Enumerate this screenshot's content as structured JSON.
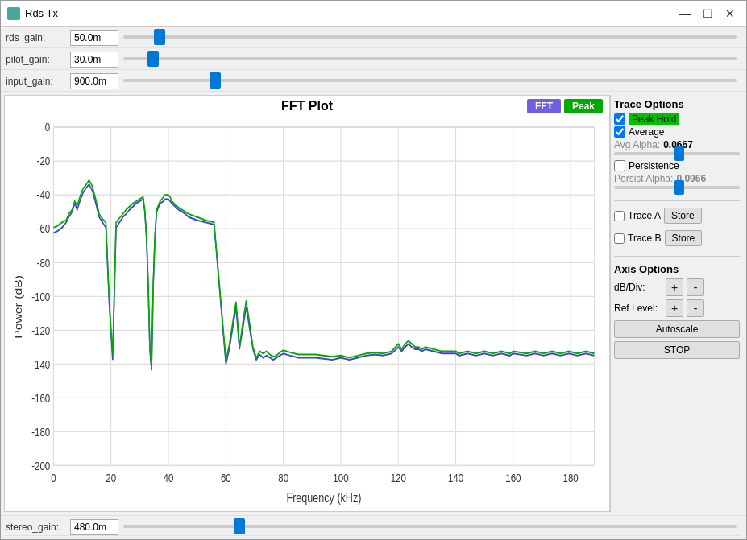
{
  "window": {
    "title": "Rds Tx",
    "icon": "rds-icon"
  },
  "sliders": [
    {
      "id": "rds_gain",
      "label": "rds_gain:",
      "value": "50.0m",
      "thumb_pct": 5
    },
    {
      "id": "pilot_gain",
      "label": "pilot_gain:",
      "value": "30.0m",
      "thumb_pct": 4
    },
    {
      "id": "input_gain",
      "label": "input_gain:",
      "value": "900.0m",
      "thumb_pct": 14
    }
  ],
  "plot": {
    "title": "FFT Plot",
    "btn_fft": "FFT",
    "btn_peak": "Peak",
    "x_label": "Frequency (kHz)",
    "y_label": "Power (dB)",
    "x_ticks": [
      "0",
      "20",
      "40",
      "60",
      "80",
      "100",
      "120",
      "140",
      "160",
      "180"
    ],
    "y_ticks": [
      "0",
      "-20",
      "-40",
      "-60",
      "-80",
      "-100",
      "-120",
      "-140",
      "-160",
      "-180",
      "-200"
    ]
  },
  "trace_options": {
    "title": "Trace Options",
    "peak_hold_label": "Peak Hold",
    "peak_hold_checked": true,
    "average_label": "Average",
    "average_checked": true,
    "avg_alpha_label": "Avg Alpha:",
    "avg_alpha_value": "0.0667",
    "avg_slider_pct": 50,
    "persistence_label": "Persistence",
    "persistence_checked": false,
    "persist_alpha_label": "Persist Alpha:",
    "persist_alpha_value": "0.0966",
    "persist_slider_pct": 50,
    "trace_a_label": "Trace A",
    "trace_a_checked": false,
    "trace_b_label": "Trace B",
    "trace_b_checked": false,
    "store_label": "Store"
  },
  "axis_options": {
    "title": "Axis Options",
    "db_div_label": "dB/Div:",
    "ref_level_label": "Ref Level:",
    "plus_label": "+",
    "minus_label": "-",
    "autoscale_label": "Autoscale",
    "stop_label": "STOP"
  },
  "bottom_slider": {
    "id": "stereo_gain",
    "label": "stereo_gain:",
    "value": "480.0m",
    "thumb_pct": 18
  }
}
